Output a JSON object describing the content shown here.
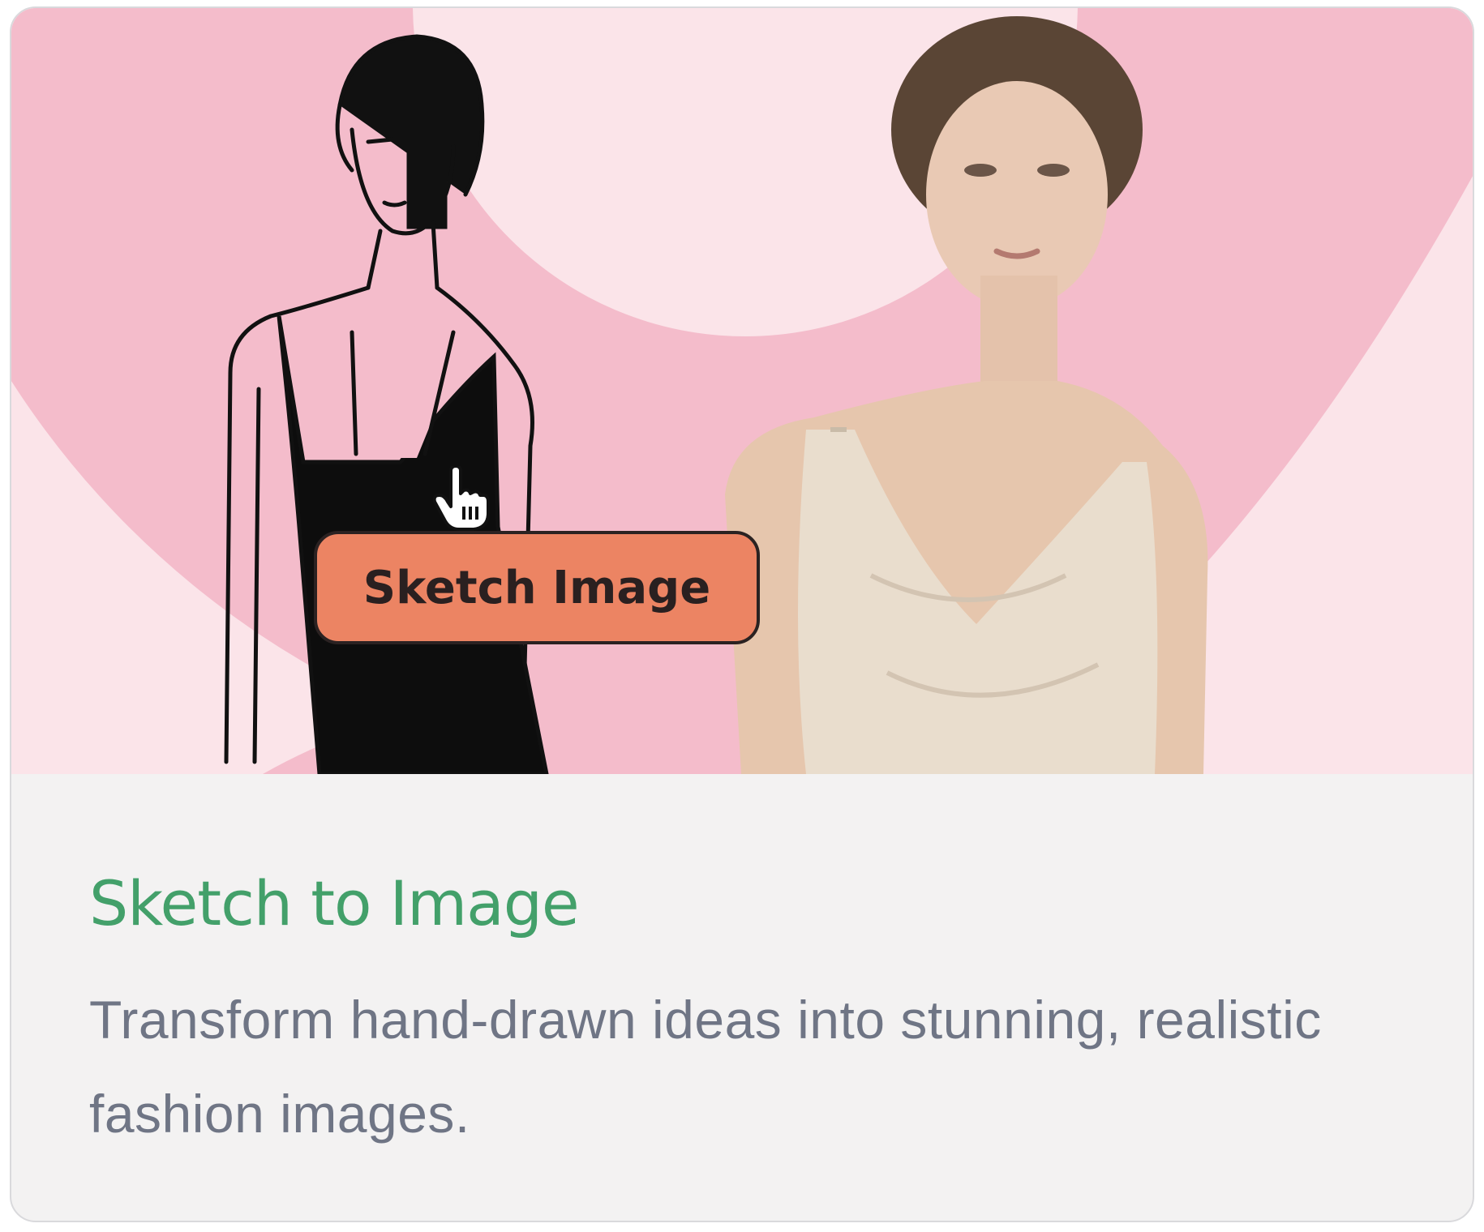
{
  "card": {
    "title": "Sketch to Image",
    "description": "Transform hand-drawn ideas into stunning, realistic fashion images.",
    "action_label": "Sketch Image"
  },
  "colors": {
    "title": "#43a06a",
    "description": "#6f7585",
    "button": "#ec8463",
    "hero_pink": "#f4bccb",
    "hero_light": "#fbe4e9",
    "card_bg": "#f3f2f2"
  },
  "icons": {
    "cursor": "hand-pointer-icon"
  }
}
